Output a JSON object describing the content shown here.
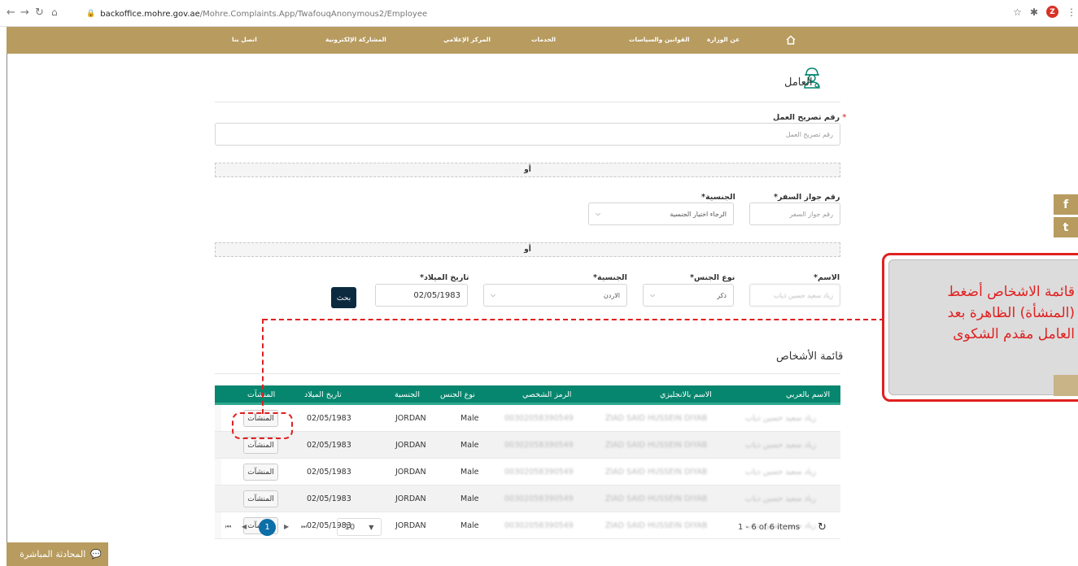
{
  "browser": {
    "url_domain": "backoffice.mohre.gov.ae",
    "url_path": "/Mohre.Complaints.App/TwafouqAnonymous2/Employee",
    "profile_initial": "Z"
  },
  "nav": {
    "home_icon": "home-icon",
    "items": [
      "عن الوزارة",
      "القوانين والسياسات",
      "الخدمات",
      "المركز الإعلامي",
      "المشاركة الإلكترونية",
      "اتصل بنا"
    ]
  },
  "section": {
    "title": "العامل",
    "icon": "worker-icon"
  },
  "form": {
    "permit_label": "رقم تصريح العمل",
    "permit_placeholder": "رقم تصريح العمل",
    "or_label": "أو",
    "passport_label": "رقم جواز السفر*",
    "passport_placeholder": "رقم جواز السفر",
    "nationality_label": "الجنسية*",
    "nationality_placeholder": "الرجاء اختيار الجنسية",
    "name_label": "الاسم*",
    "name_value": "زياد سعيد حسين ذياب",
    "gender_label": "نوع الجنس*",
    "gender_value": "ذكر",
    "nationality2_label": "الجنسية*",
    "nationality2_value": "الاردن",
    "dob_label": "تاريخ الميلاد*",
    "dob_value": "02/05/1983",
    "search_button": "بحث"
  },
  "list": {
    "title": "قائمة الأشخاص",
    "columns": [
      "الاسم بالعربي",
      "الاسم بالانجليزي",
      "الرمز الشخصي",
      "نوع الجنس",
      "الجنسية",
      "تاريخ الميلاد",
      "المنشآت"
    ],
    "rows": [
      {
        "name_ar": "زياد سعيد حسين ذياب",
        "name_en": "ZIAD SAID HUSSEIN DIYAB",
        "uid": "00302058390549",
        "gender": "Male",
        "nationality": "JORDAN",
        "dob": "02/05/1983",
        "action": "المنشآت"
      },
      {
        "name_ar": "زياد سعيد حسين ذياب",
        "name_en": "ZIAD SAID HUSSEIN DIYAB",
        "uid": "00302058390549",
        "gender": "Male",
        "nationality": "JORDAN",
        "dob": "02/05/1983",
        "action": "المنشآت"
      },
      {
        "name_ar": "زياد سعيد حسين ذياب",
        "name_en": "ZIAD SAID HUSSEIN DIYAB",
        "uid": "00302058390549",
        "gender": "Male",
        "nationality": "JORDAN",
        "dob": "02/05/1983",
        "action": "المنشآت"
      },
      {
        "name_ar": "زياد سعيد حسين ذياب",
        "name_en": "ZIAD SAID HUSSEIN DIYAB",
        "uid": "00302058390549",
        "gender": "Male",
        "nationality": "JORDAN",
        "dob": "02/05/1983",
        "action": "المنشآت"
      },
      {
        "name_ar": "زياد سعيد حسين ذياب",
        "name_en": "ZIAD SAID HUSSEIN DIYAB",
        "uid": "00302058390549",
        "gender": "Male",
        "nationality": "JORDAN",
        "dob": "02/05/1983",
        "action": "المنشآت"
      }
    ],
    "pager": {
      "current_page": "1",
      "page_size": "10",
      "info": "1 - 6 of 6 items"
    }
  },
  "callout": {
    "lines": [
      "قائمة الاشخاص أضغط",
      "(المنشأة) الظاهرة بعد",
      "العامل مقدم الشكوى"
    ],
    "color": "#e02020"
  },
  "social": [
    "f",
    "t"
  ],
  "livechat": {
    "label": "المحادثة المباشرة"
  },
  "colors": {
    "nav_bg": "#b79b5f",
    "grid_header": "#06866e",
    "search_button": "#0b2a40",
    "page_current": "#0d6ea8"
  }
}
